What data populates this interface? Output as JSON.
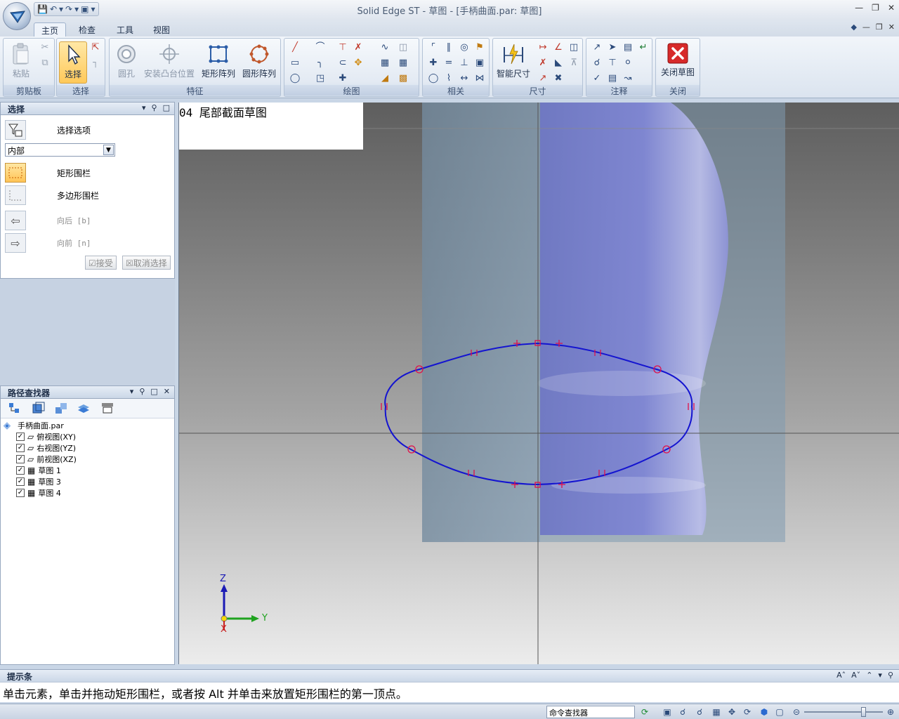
{
  "window": {
    "title": "Solid Edge ST - 草图 - [手柄曲面.par: 草图]"
  },
  "tabs": [
    {
      "label": "主页",
      "active": true
    },
    {
      "label": "检查"
    },
    {
      "label": "工具"
    },
    {
      "label": "视图"
    }
  ],
  "ribbon": {
    "groups": {
      "clipboard": "剪贴板",
      "select": "选择",
      "features": "特征",
      "draw": "绘图",
      "relate": "相关",
      "dimension": "尺寸",
      "annotation": "注释",
      "close": "关闭"
    },
    "buttons": {
      "paste": "粘贴",
      "select": "选择",
      "hole": "圆孔",
      "boss": "安装凸台位置",
      "rect_pattern": "矩形阵列",
      "circ_pattern": "圆形阵列",
      "smart_dim": "智能尺寸",
      "close_sketch": "关闭草图"
    }
  },
  "select_panel": {
    "title": "选择",
    "options_label": "选择选项",
    "mode_value": "内部",
    "rect_fence": "矩形围栏",
    "poly_fence": "多边形围栏",
    "back": "向后 [b]",
    "forward": "向前 [n]",
    "accept": "接受",
    "cancel_select": "取消选择"
  },
  "pathfinder": {
    "title": "路径查找器",
    "root": "手柄曲面.par",
    "items": [
      {
        "label": "俯视图(XY)",
        "checked": true,
        "icon": "plane-icon"
      },
      {
        "label": "右视图(YZ)",
        "checked": true,
        "icon": "plane-icon"
      },
      {
        "label": "前视图(XZ)",
        "checked": true,
        "icon": "plane-icon"
      },
      {
        "label": "草图 1",
        "checked": true,
        "icon": "sketch-icon"
      },
      {
        "label": "草图 3",
        "checked": true,
        "icon": "sketch-icon"
      },
      {
        "label": "草图 4",
        "checked": true,
        "icon": "sketch-icon"
      }
    ]
  },
  "viewport": {
    "sketch_label": "04 尾部截面草图",
    "axis_z": "Z",
    "axis_y": "Y",
    "axis_x": "X"
  },
  "prompt_bar": {
    "title": "提示条",
    "message": "单击元素，单击并拖动矩形围栏，或者按 Alt 并单击来放置矩形围栏的第一顶点。"
  },
  "status_bar": {
    "command_finder": "命令查找器"
  },
  "colors": {
    "sketch_curve": "#1414d0",
    "constraint": "#e0104a",
    "ribbon_bg": "#dbe4ef",
    "accent": "#ffc95a"
  }
}
